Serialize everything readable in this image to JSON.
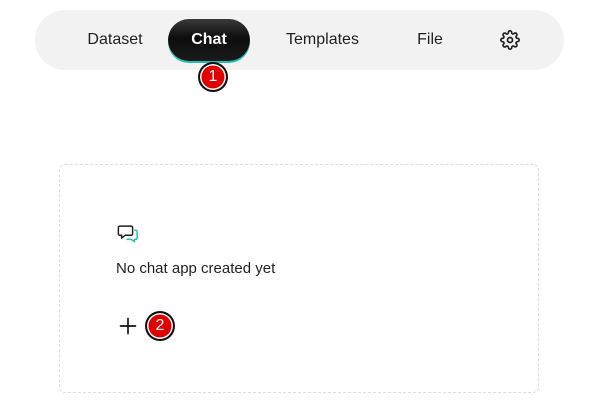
{
  "nav": {
    "items": [
      {
        "id": "dataset",
        "label": "Dataset"
      },
      {
        "id": "chat",
        "label": "Chat",
        "active": true
      },
      {
        "id": "templates",
        "label": "Templates"
      },
      {
        "id": "file",
        "label": "File"
      }
    ],
    "settings_icon": "gear-icon"
  },
  "badges": {
    "first": "1",
    "second": "2"
  },
  "empty_state": {
    "icon": "chat-bubbles-icon",
    "message": "No chat app created yet",
    "add_icon": "plus-icon"
  },
  "colors": {
    "accent_teal": "#22bfae",
    "badge_red": "#e10000",
    "nav_bg": "#f2f2f2",
    "active_tab_bg": "#111111"
  }
}
